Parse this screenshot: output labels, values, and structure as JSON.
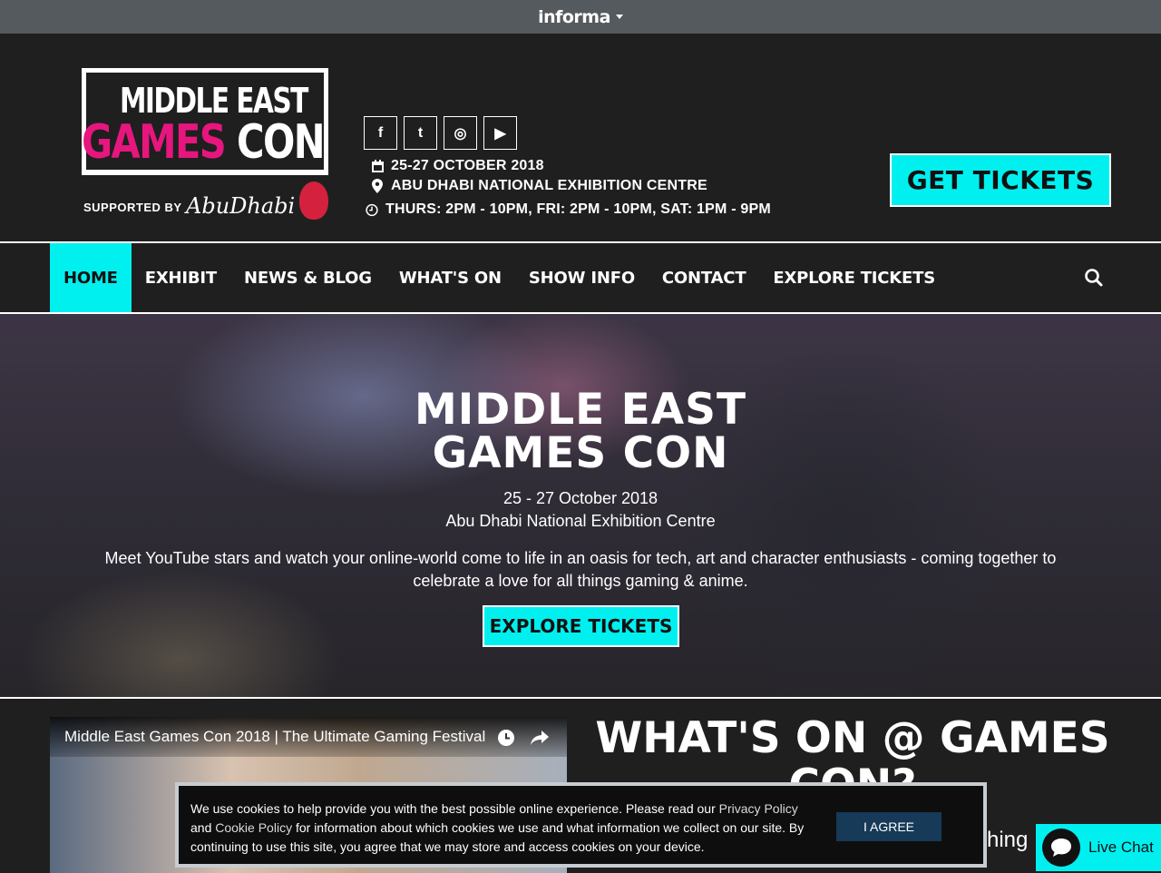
{
  "topbar": {
    "brand": "informa"
  },
  "logo": {
    "line1": "MIDDLE EAST",
    "games": "GAMES",
    "con": "CON",
    "supported_by": "SUPPORTED BY",
    "partner": "AbuDhabi"
  },
  "social": [
    {
      "icon": "facebook-icon",
      "glyph": "f"
    },
    {
      "icon": "twitter-icon",
      "glyph": "t"
    },
    {
      "icon": "instagram-icon",
      "glyph": "◎"
    },
    {
      "icon": "youtube-icon",
      "glyph": "▶"
    }
  ],
  "event_info": {
    "date": "25-27 OCTOBER 2018",
    "venue": "ABU DHABI NATIONAL EXHIBITION CENTRE",
    "hours": "THURS: 2PM - 10PM, FRI: 2PM - 10PM, SAT: 1PM - 9PM"
  },
  "header_cta": "GET TICKETS",
  "nav": {
    "items": [
      {
        "label": "HOME",
        "active": true
      },
      {
        "label": "EXHIBIT",
        "active": false
      },
      {
        "label": "NEWS & BLOG",
        "active": false
      },
      {
        "label": "WHAT'S ON",
        "active": false
      },
      {
        "label": "SHOW INFO",
        "active": false
      },
      {
        "label": "CONTACT",
        "active": false
      },
      {
        "label": "EXPLORE TICKETS",
        "active": false
      }
    ]
  },
  "hero": {
    "title_line1": "MIDDLE EAST",
    "title_line2": "GAMES CON",
    "date": "25 - 27 October 2018",
    "venue": "Abu Dhabi National Exhibition Centre",
    "description": "Meet YouTube stars and watch your online-world come to life in an oasis for tech, art and character enthusiasts - coming together to celebrate a love for all things gaming & anime.",
    "cta": "EXPLORE TICKETS"
  },
  "video": {
    "title": "Middle East Games Con 2018 | The Ultimate Gaming Festival"
  },
  "whats_on": {
    "heading_line1": "WHAT'S ON @ GAMES",
    "heading_line2": "CON?",
    "partial_text": "hing"
  },
  "cookie": {
    "text_1": "We use cookies to help provide you with the best possible online experience. Please read our ",
    "link_privacy": "Privacy Policy",
    "text_2": " and ",
    "link_cookie": "Cookie Policy",
    "text_3": " for information about which cookies we use and what information we collect on our site. By continuing to use this site, you agree that we may store and access cookies on your device.",
    "agree_label": "I AGREE"
  },
  "livechat": {
    "label": "Live Chat"
  },
  "colors": {
    "accent": "#00f0f0",
    "brand_pink": "#e6167e",
    "dark_bg": "#1f1f1f",
    "topbar": "#555a5e",
    "cookie_button": "#163a58"
  }
}
